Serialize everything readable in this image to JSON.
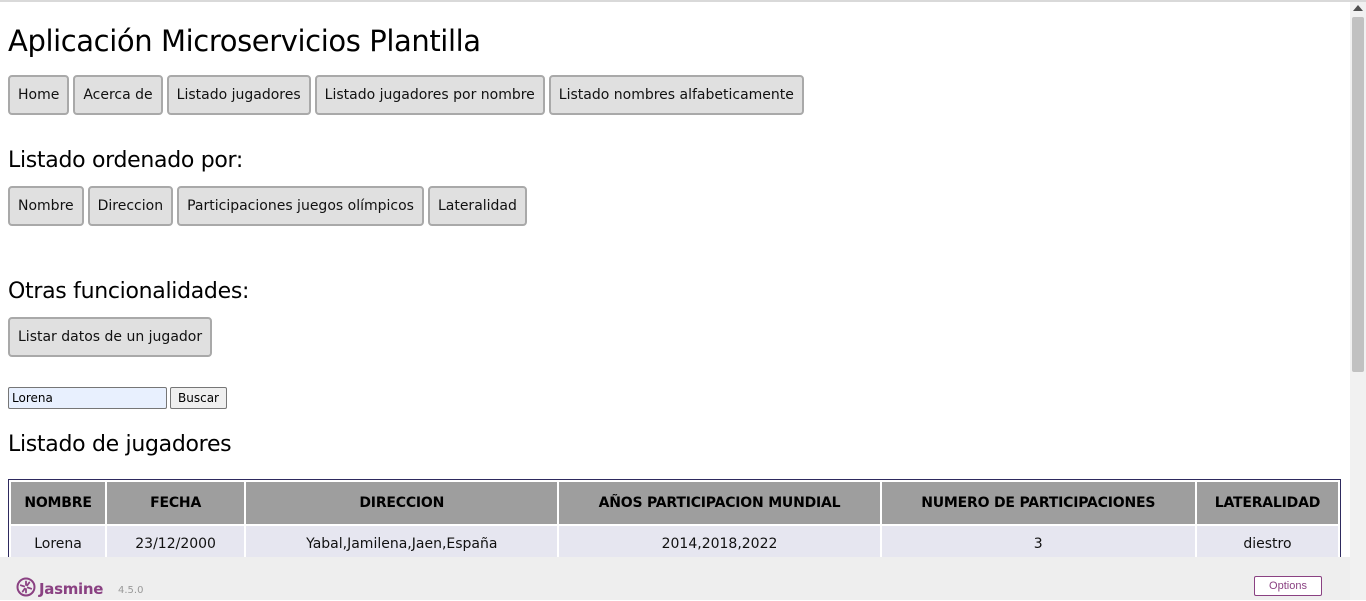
{
  "app": {
    "title": "Aplicación Microservicios Plantilla"
  },
  "nav": {
    "buttons": [
      "Home",
      "Acerca de",
      "Listado jugadores",
      "Listado jugadores por nombre",
      "Listado nombres alfabeticamente"
    ]
  },
  "sort_section": {
    "heading": "Listado ordenado por:",
    "buttons": [
      "Nombre",
      "Direccion",
      "Participaciones juegos olímpicos",
      "Lateralidad"
    ]
  },
  "other_section": {
    "heading": "Otras funcionalidades:",
    "button": "Listar datos de un jugador"
  },
  "search": {
    "value": "Lorena",
    "button": "Buscar"
  },
  "players": {
    "heading": "Listado de jugadores",
    "columns": [
      "NOMBRE",
      "FECHA",
      "DIRECCION",
      "AÑOS PARTICIPACION MUNDIAL",
      "NUMERO DE PARTICIPACIONES",
      "LATERALIDAD"
    ],
    "rows": [
      [
        "Lorena",
        "23/12/2000",
        "Yabal,Jamilena,Jaen,España",
        "2014,2018,2022",
        "3",
        "diestro"
      ]
    ]
  },
  "jasmine": {
    "name": "Jasmine",
    "version": "4.5.0",
    "options": "Options",
    "brand_color": "#8a4182",
    "icon": "jasmine-flower-icon"
  }
}
